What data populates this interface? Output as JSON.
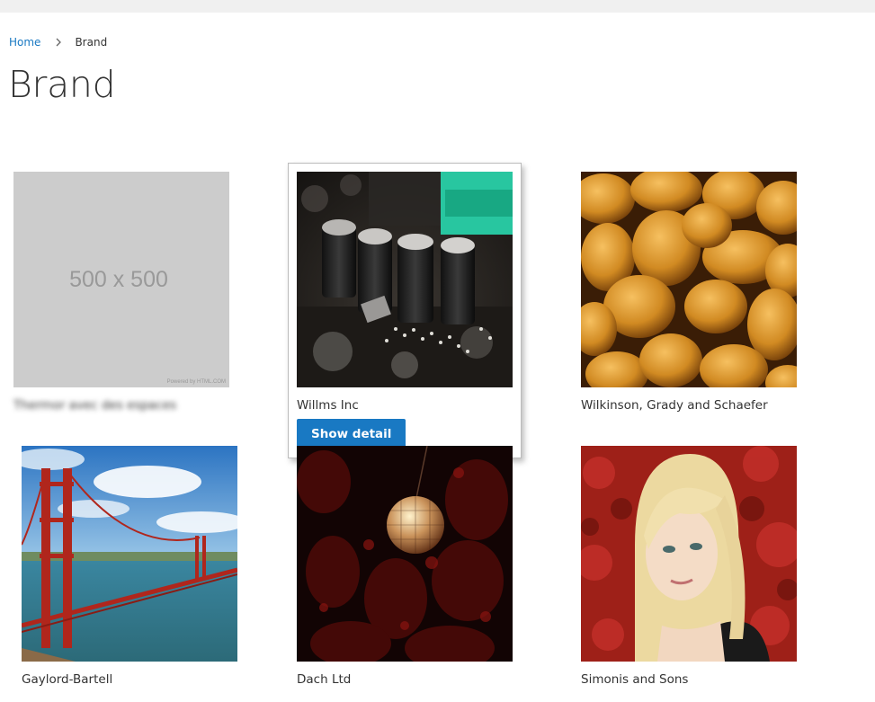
{
  "breadcrumb": {
    "home": "Home",
    "current": "Brand"
  },
  "page": {
    "title": "Brand"
  },
  "brands": [
    {
      "name": "Thermor avec des espaces",
      "image": "placeholder",
      "placeholder_text": "500 x 500",
      "powered_by": "Powered by HTML.COM"
    },
    {
      "name": "Willms Inc",
      "image": "circuit-board",
      "button": "Show detail"
    },
    {
      "name": "Wilkinson, Grady and Schaefer",
      "image": "nuts"
    },
    {
      "name": "Gaylord-Bartell",
      "image": "golden-gate-bridge"
    },
    {
      "name": "Dach Ltd",
      "image": "disco-ball"
    },
    {
      "name": "Simonis and Sons",
      "image": "blonde-woman"
    }
  ],
  "colors": {
    "link": "#1979c3",
    "button": "#1979c3",
    "placeholder": "#cccccc"
  }
}
